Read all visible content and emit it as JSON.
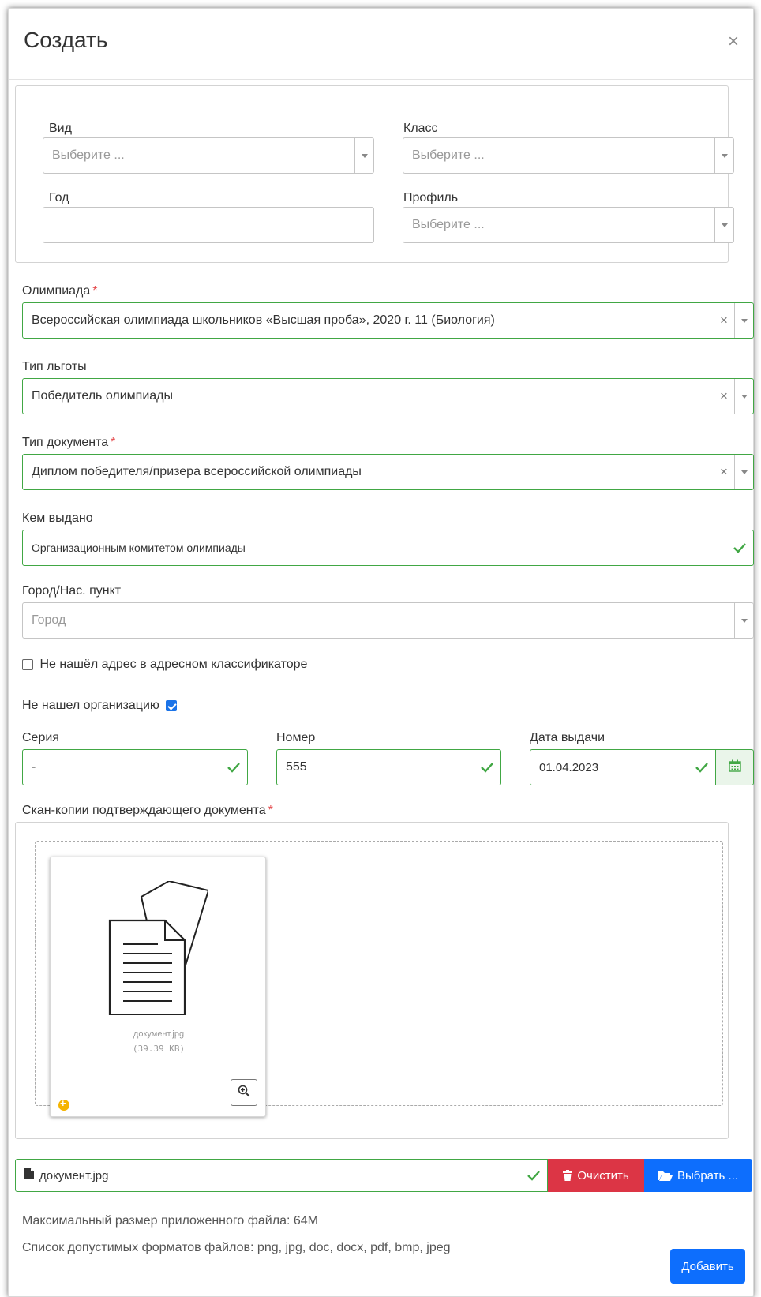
{
  "modal": {
    "title": "Создать",
    "close": "×"
  },
  "filters": {
    "vid": {
      "label": "Вид",
      "placeholder": "Выберите ..."
    },
    "klass": {
      "label": "Класс",
      "placeholder": "Выберите ..."
    },
    "god": {
      "label": "Год",
      "value": ""
    },
    "profil": {
      "label": "Профиль",
      "placeholder": "Выберите ..."
    }
  },
  "olympiad": {
    "label": "Олимпиада",
    "required": "*",
    "value": "Всероссийская олимпиада школьников «Высшая проба», 2020 г. 11 (Биология)"
  },
  "benefit_type": {
    "label": "Тип льготы",
    "value": "Победитель олимпиады"
  },
  "document_type": {
    "label": "Тип документа",
    "required": "*",
    "value": "Диплом победителя/призера всероссийской олимпиады"
  },
  "issued_by": {
    "label": "Кем выдано",
    "value": "Организационным комитетом олимпиады"
  },
  "city": {
    "label": "Город/Нас. пункт",
    "placeholder": "Город"
  },
  "address_not_found": {
    "label": "Не нашёл адрес в адресном классификаторе",
    "checked": false
  },
  "org_not_found": {
    "label": "Не нашел организацию",
    "checked": true
  },
  "series": {
    "label": "Серия",
    "value": "-"
  },
  "number": {
    "label": "Номер",
    "value": "555"
  },
  "issue_date": {
    "label": "Дата выдачи",
    "value": "01.04.2023"
  },
  "scans": {
    "label": "Скан-копии подтверждающего документа",
    "required": "*",
    "file_name": "документ.jpg",
    "file_size": "(39.39 KB)"
  },
  "file_field": {
    "value": "документ.jpg",
    "clear_label": "Очистить",
    "browse_label": "Выбрать ..."
  },
  "info": {
    "max_size": "Максимальный размер приложенного файла: 64M",
    "formats": "Список допустимых форматов файлов: png, jpg, doc, docx, pdf, bmp, jpeg"
  },
  "submit_label": "Добавить",
  "colors": {
    "success": "#41a744",
    "danger": "#dc3545",
    "primary": "#0d6efd",
    "required": "#e4484b"
  }
}
